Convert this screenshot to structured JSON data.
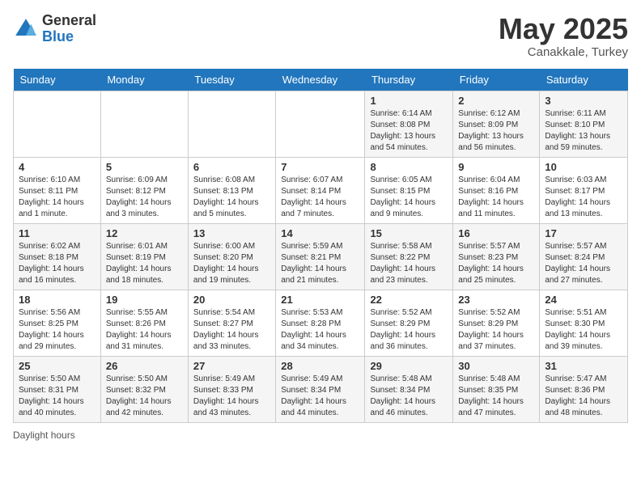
{
  "header": {
    "logo_general": "General",
    "logo_blue": "Blue",
    "title_month": "May 2025",
    "title_location": "Canakkale, Turkey"
  },
  "days_of_week": [
    "Sunday",
    "Monday",
    "Tuesday",
    "Wednesday",
    "Thursday",
    "Friday",
    "Saturday"
  ],
  "weeks": [
    [
      {
        "day": "",
        "info": ""
      },
      {
        "day": "",
        "info": ""
      },
      {
        "day": "",
        "info": ""
      },
      {
        "day": "",
        "info": ""
      },
      {
        "day": "1",
        "info": "Sunrise: 6:14 AM\nSunset: 8:08 PM\nDaylight: 13 hours and 54 minutes."
      },
      {
        "day": "2",
        "info": "Sunrise: 6:12 AM\nSunset: 8:09 PM\nDaylight: 13 hours and 56 minutes."
      },
      {
        "day": "3",
        "info": "Sunrise: 6:11 AM\nSunset: 8:10 PM\nDaylight: 13 hours and 59 minutes."
      }
    ],
    [
      {
        "day": "4",
        "info": "Sunrise: 6:10 AM\nSunset: 8:11 PM\nDaylight: 14 hours and 1 minute."
      },
      {
        "day": "5",
        "info": "Sunrise: 6:09 AM\nSunset: 8:12 PM\nDaylight: 14 hours and 3 minutes."
      },
      {
        "day": "6",
        "info": "Sunrise: 6:08 AM\nSunset: 8:13 PM\nDaylight: 14 hours and 5 minutes."
      },
      {
        "day": "7",
        "info": "Sunrise: 6:07 AM\nSunset: 8:14 PM\nDaylight: 14 hours and 7 minutes."
      },
      {
        "day": "8",
        "info": "Sunrise: 6:05 AM\nSunset: 8:15 PM\nDaylight: 14 hours and 9 minutes."
      },
      {
        "day": "9",
        "info": "Sunrise: 6:04 AM\nSunset: 8:16 PM\nDaylight: 14 hours and 11 minutes."
      },
      {
        "day": "10",
        "info": "Sunrise: 6:03 AM\nSunset: 8:17 PM\nDaylight: 14 hours and 13 minutes."
      }
    ],
    [
      {
        "day": "11",
        "info": "Sunrise: 6:02 AM\nSunset: 8:18 PM\nDaylight: 14 hours and 16 minutes."
      },
      {
        "day": "12",
        "info": "Sunrise: 6:01 AM\nSunset: 8:19 PM\nDaylight: 14 hours and 18 minutes."
      },
      {
        "day": "13",
        "info": "Sunrise: 6:00 AM\nSunset: 8:20 PM\nDaylight: 14 hours and 19 minutes."
      },
      {
        "day": "14",
        "info": "Sunrise: 5:59 AM\nSunset: 8:21 PM\nDaylight: 14 hours and 21 minutes."
      },
      {
        "day": "15",
        "info": "Sunrise: 5:58 AM\nSunset: 8:22 PM\nDaylight: 14 hours and 23 minutes."
      },
      {
        "day": "16",
        "info": "Sunrise: 5:57 AM\nSunset: 8:23 PM\nDaylight: 14 hours and 25 minutes."
      },
      {
        "day": "17",
        "info": "Sunrise: 5:57 AM\nSunset: 8:24 PM\nDaylight: 14 hours and 27 minutes."
      }
    ],
    [
      {
        "day": "18",
        "info": "Sunrise: 5:56 AM\nSunset: 8:25 PM\nDaylight: 14 hours and 29 minutes."
      },
      {
        "day": "19",
        "info": "Sunrise: 5:55 AM\nSunset: 8:26 PM\nDaylight: 14 hours and 31 minutes."
      },
      {
        "day": "20",
        "info": "Sunrise: 5:54 AM\nSunset: 8:27 PM\nDaylight: 14 hours and 33 minutes."
      },
      {
        "day": "21",
        "info": "Sunrise: 5:53 AM\nSunset: 8:28 PM\nDaylight: 14 hours and 34 minutes."
      },
      {
        "day": "22",
        "info": "Sunrise: 5:52 AM\nSunset: 8:29 PM\nDaylight: 14 hours and 36 minutes."
      },
      {
        "day": "23",
        "info": "Sunrise: 5:52 AM\nSunset: 8:29 PM\nDaylight: 14 hours and 37 minutes."
      },
      {
        "day": "24",
        "info": "Sunrise: 5:51 AM\nSunset: 8:30 PM\nDaylight: 14 hours and 39 minutes."
      }
    ],
    [
      {
        "day": "25",
        "info": "Sunrise: 5:50 AM\nSunset: 8:31 PM\nDaylight: 14 hours and 40 minutes."
      },
      {
        "day": "26",
        "info": "Sunrise: 5:50 AM\nSunset: 8:32 PM\nDaylight: 14 hours and 42 minutes."
      },
      {
        "day": "27",
        "info": "Sunrise: 5:49 AM\nSunset: 8:33 PM\nDaylight: 14 hours and 43 minutes."
      },
      {
        "day": "28",
        "info": "Sunrise: 5:49 AM\nSunset: 8:34 PM\nDaylight: 14 hours and 44 minutes."
      },
      {
        "day": "29",
        "info": "Sunrise: 5:48 AM\nSunset: 8:34 PM\nDaylight: 14 hours and 46 minutes."
      },
      {
        "day": "30",
        "info": "Sunrise: 5:48 AM\nSunset: 8:35 PM\nDaylight: 14 hours and 47 minutes."
      },
      {
        "day": "31",
        "info": "Sunrise: 5:47 AM\nSunset: 8:36 PM\nDaylight: 14 hours and 48 minutes."
      }
    ]
  ],
  "footer": {
    "label": "Daylight hours"
  }
}
